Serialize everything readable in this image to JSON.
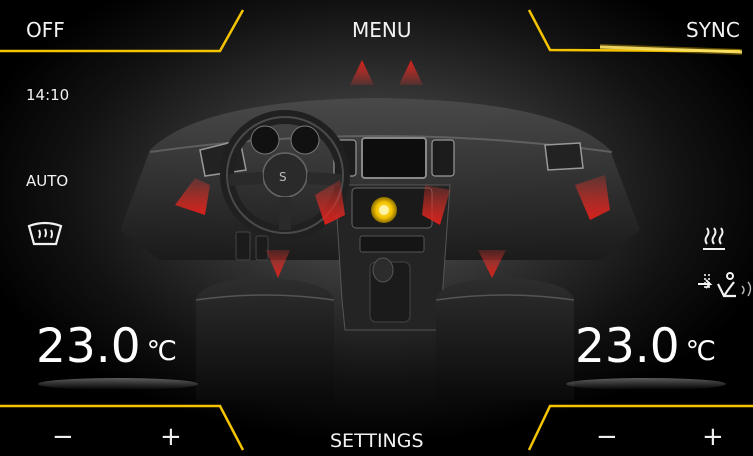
{
  "header": {
    "off_label": "OFF",
    "menu_label": "MENU",
    "sync_label": "SYNC"
  },
  "status": {
    "time": "14:10",
    "mode": "AUTO"
  },
  "left_zone": {
    "temperature": "23.0",
    "unit": "℃",
    "minus_label": "−",
    "plus_label": "+"
  },
  "right_zone": {
    "temperature": "23.0",
    "unit": "℃",
    "minus_label": "−",
    "plus_label": "+"
  },
  "footer": {
    "settings_label": "SETTINGS"
  },
  "icons": {
    "windshield": "windshield-defrost-icon",
    "seat_heat": "seat-heating-icon",
    "air_distribution": "air-distribution-seat-icon"
  },
  "colors": {
    "accent": "#f5c400",
    "airflow": "#d6201b",
    "background": "#000000"
  }
}
